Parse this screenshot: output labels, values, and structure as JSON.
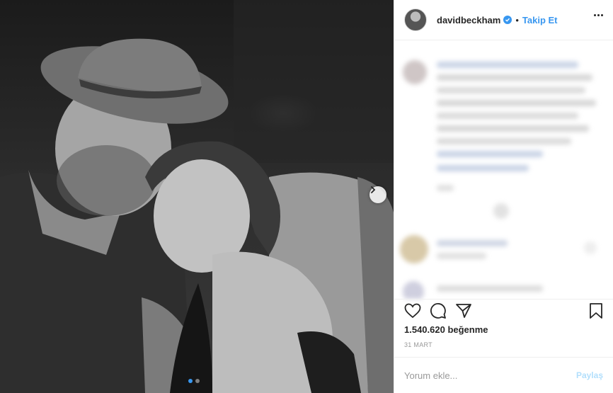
{
  "post": {
    "username": "davidbeckham",
    "separator": "•",
    "follow_label": "Takip Et",
    "likes_text": "1.540.620 beğenme",
    "date_text": "31 MART"
  },
  "comment_box": {
    "placeholder": "Yorum ekle...",
    "post_label": "Paylaş"
  },
  "icons": {
    "like": "heart-icon",
    "comment": "comment-icon",
    "share": "share-icon",
    "save": "bookmark-icon",
    "more": "more-options-icon",
    "verified": "verified-badge-icon",
    "carousel_next": "chevron-right-icon"
  },
  "colors": {
    "accent": "#3897f0",
    "text": "#262626",
    "muted": "#999999",
    "post_button_disabled": "#b2dffc"
  }
}
